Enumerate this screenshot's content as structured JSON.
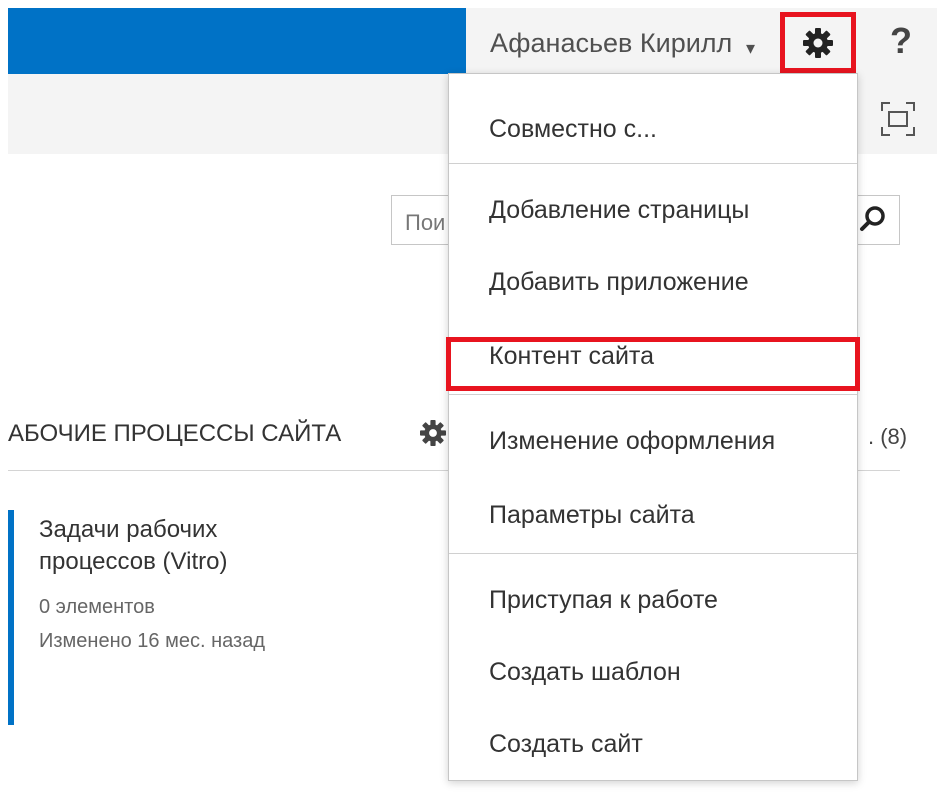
{
  "suite_bar": {
    "user_name": "Афанасьев Кирилл",
    "user_caret": "▾",
    "help_label": "?"
  },
  "search": {
    "placeholder": "Пои"
  },
  "section": {
    "title": "АБОЧИЕ ПРОЦЕССЫ САЙТА",
    "count": ". (8)"
  },
  "tile": {
    "title": "Задачи рабочих процессов (Vitro)",
    "count": "0 элементов",
    "modified": "Изменено 16 мес. назад"
  },
  "menu": {
    "items": [
      {
        "label": "Совместно с..."
      },
      {
        "label": "Добавление страницы"
      },
      {
        "label": "Добавить приложение"
      },
      {
        "label": "Контент сайта"
      },
      {
        "label": "Изменение оформления"
      },
      {
        "label": "Параметры сайта"
      },
      {
        "label": "Приступая к работе"
      },
      {
        "label": "Создать шаблон"
      },
      {
        "label": "Создать сайт"
      }
    ]
  },
  "colors": {
    "suite_blue": "#0072c6",
    "highlight_red": "#e8141f"
  },
  "icons": [
    "gear-icon",
    "help-icon",
    "focus-mode-icon",
    "search-icon",
    "chevron-down-icon"
  ]
}
